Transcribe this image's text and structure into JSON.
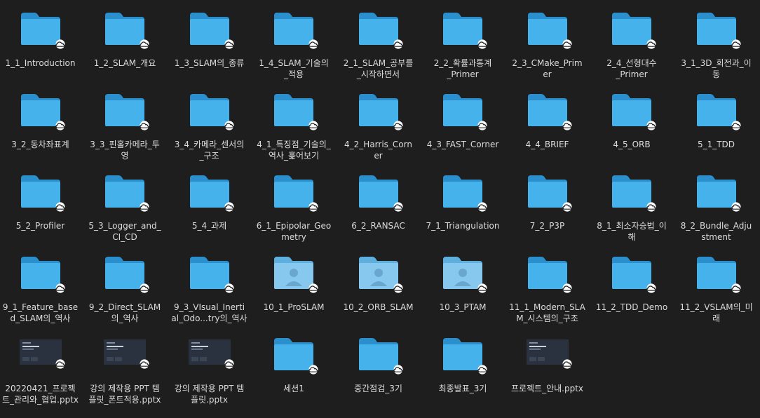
{
  "colors": {
    "background": "#1e1e1e",
    "folder_front": "#45b2ec",
    "folder_back": "#2c8fcd",
    "shared_folder_front": "#87c8ee",
    "shared_folder_back": "#5eaede",
    "label_text": "#dcdcdc"
  },
  "items": [
    {
      "label": "1_1_Introduction",
      "kind": "folder",
      "icon": "folder-icon"
    },
    {
      "label": "1_2_SLAM_개요",
      "kind": "folder",
      "icon": "folder-icon"
    },
    {
      "label": "1_3_SLAM의_종류",
      "kind": "folder",
      "icon": "folder-icon"
    },
    {
      "label": "1_4_SLAM_기술의\n_적용",
      "kind": "folder",
      "icon": "folder-icon"
    },
    {
      "label": "2_1_SLAM_공부를\n_시작하면서",
      "kind": "folder",
      "icon": "folder-icon"
    },
    {
      "label": "2_2_확률과통계\n_Primer",
      "kind": "folder",
      "icon": "folder-icon"
    },
    {
      "label": "2_3_CMake_Prim\ner",
      "kind": "folder",
      "icon": "folder-icon"
    },
    {
      "label": "2_4_선형대수\n_Primer",
      "kind": "folder",
      "icon": "folder-icon"
    },
    {
      "label": "3_1_3D_회전과_이\n동",
      "kind": "folder",
      "icon": "folder-icon"
    },
    {
      "label": "3_2_동차좌표계",
      "kind": "folder",
      "icon": "folder-icon"
    },
    {
      "label": "3_3_핀홀카메라_투\n영",
      "kind": "folder",
      "icon": "folder-icon"
    },
    {
      "label": "3_4_카메라_센서의\n_구조",
      "kind": "folder",
      "icon": "folder-icon"
    },
    {
      "label": "4_1_특징점_기술의_\n역사_훑어보기",
      "kind": "folder",
      "icon": "folder-icon"
    },
    {
      "label": "4_2_Harris_Corn\ner",
      "kind": "folder",
      "icon": "folder-icon"
    },
    {
      "label": "4_3_FAST_Corner",
      "kind": "folder",
      "icon": "folder-icon"
    },
    {
      "label": "4_4_BRIEF",
      "kind": "folder",
      "icon": "folder-icon"
    },
    {
      "label": "4_5_ORB",
      "kind": "folder",
      "icon": "folder-icon"
    },
    {
      "label": "5_1_TDD",
      "kind": "folder",
      "icon": "folder-icon"
    },
    {
      "label": "5_2_Profiler",
      "kind": "folder",
      "icon": "folder-icon"
    },
    {
      "label": "5_3_Logger_and_\nCI_CD",
      "kind": "folder",
      "icon": "folder-icon"
    },
    {
      "label": "5_4_과제",
      "kind": "folder",
      "icon": "folder-icon"
    },
    {
      "label": "6_1_Epipolar_Geo\nmetry",
      "kind": "folder",
      "icon": "folder-icon"
    },
    {
      "label": "6_2_RANSAC",
      "kind": "folder",
      "icon": "folder-icon"
    },
    {
      "label": "7_1_Triangulation",
      "kind": "folder",
      "icon": "folder-icon"
    },
    {
      "label": "7_2_P3P",
      "kind": "folder",
      "icon": "folder-icon"
    },
    {
      "label": "8_1_최소자승법_이\n해",
      "kind": "folder",
      "icon": "folder-icon"
    },
    {
      "label": "8_2_Bundle_Adju\nstment",
      "kind": "folder",
      "icon": "folder-icon"
    },
    {
      "label": "9_1_Feature_base\nd_SLAM의_역사",
      "kind": "folder",
      "icon": "folder-icon"
    },
    {
      "label": "9_2_Direct_SLAM\n의_역사",
      "kind": "folder",
      "icon": "folder-icon"
    },
    {
      "label": "9_3_VIsual_Inerti\nal_Odo...try의_역사",
      "kind": "folder",
      "icon": "folder-icon"
    },
    {
      "label": "10_1_ProSLAM",
      "kind": "shared",
      "icon": "shared-folder-icon"
    },
    {
      "label": "10_2_ORB_SLAM",
      "kind": "shared",
      "icon": "shared-folder-icon"
    },
    {
      "label": "10_3_PTAM",
      "kind": "shared",
      "icon": "shared-folder-icon"
    },
    {
      "label": "11_1_Modern_SLA\nM_시스템의_구조",
      "kind": "folder",
      "icon": "folder-icon"
    },
    {
      "label": "11_2_TDD_Demo",
      "kind": "folder",
      "icon": "folder-icon"
    },
    {
      "label": "11_2_VSLAM의_미\n래",
      "kind": "folder",
      "icon": "folder-icon"
    },
    {
      "label": "20220421_프로젝\n트_관리와_협업.pptx",
      "kind": "pptx",
      "icon": "pptx-thumbnail-icon"
    },
    {
      "label": "강의 제작용  PPT 템\n플릿_폰트적용.pptx",
      "kind": "pptx",
      "icon": "pptx-thumbnail-icon"
    },
    {
      "label": "강의 제작용 PPT 템\n플릿.pptx",
      "kind": "pptx",
      "icon": "pptx-thumbnail-icon"
    },
    {
      "label": "세션1",
      "kind": "folder",
      "icon": "folder-icon"
    },
    {
      "label": "중간점검_3기",
      "kind": "folder",
      "icon": "folder-icon"
    },
    {
      "label": "최종발표_3기",
      "kind": "folder",
      "icon": "folder-icon"
    },
    {
      "label": "프로젝트_안내.pptx",
      "kind": "pptx",
      "icon": "pptx-thumbnail-icon"
    }
  ]
}
